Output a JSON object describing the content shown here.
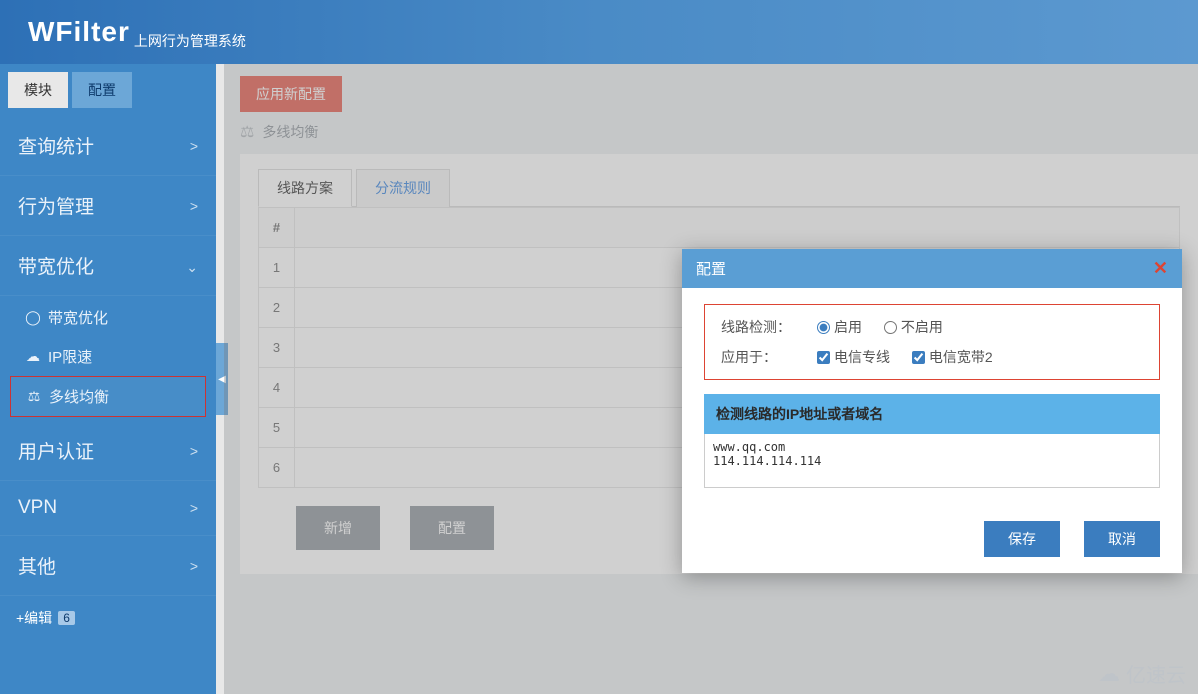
{
  "header": {
    "logo": "WFilter",
    "subtitle": "上网行为管理系统"
  },
  "sidebar": {
    "tabs": {
      "modules": "模块",
      "config": "配置"
    },
    "items": {
      "query": "查询统计",
      "behavior": "行为管理",
      "bandwidth": "带宽优化",
      "userauth": "用户认证",
      "vpn": "VPN",
      "other": "其他"
    },
    "sub_bandwidth": {
      "opt": "带宽优化",
      "iplimit": "IP限速",
      "multiline": "多线均衡"
    },
    "edit": {
      "label": "+编辑",
      "count": "6"
    }
  },
  "main": {
    "apply_btn": "应用新配置",
    "breadcrumb": "多线均衡",
    "tabs": {
      "plan": "线路方案",
      "rule": "分流规则"
    },
    "col_hash": "#",
    "rows": [
      "1",
      "2",
      "3",
      "4",
      "5",
      "6"
    ],
    "buttons": {
      "add": "新增",
      "config": "配置"
    }
  },
  "modal": {
    "title": "配置",
    "detect_label": "线路检测：",
    "radio_enable": "启用",
    "radio_disable": "不启用",
    "apply_label": "应用于：",
    "chk1": "电信专线",
    "chk2": "电信宽带2",
    "detect_header": "检测线路的IP地址或者域名",
    "textarea": "www.qq.com\n114.114.114.114",
    "save": "保存",
    "cancel": "取消"
  },
  "watermark": "亿速云"
}
